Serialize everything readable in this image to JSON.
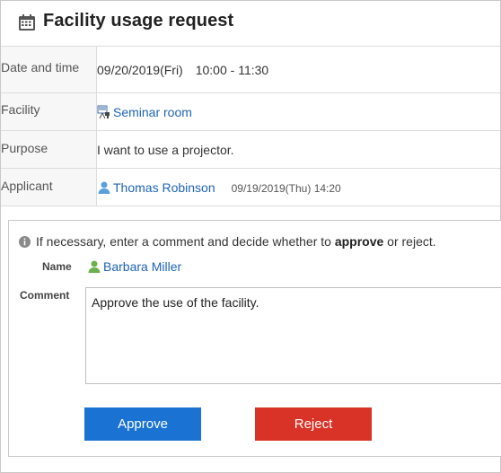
{
  "header": {
    "title": "Facility usage request",
    "icon": "calendar-icon"
  },
  "details": {
    "date_label": "Date and time",
    "date": "09/20/2019(Fri)",
    "time": "10:00 - 11:30",
    "facility_label": "Facility",
    "facility": "Seminar room",
    "facility_icon": "facility-icon",
    "purpose_label": "Purpose",
    "purpose": "I want to use a projector.",
    "applicant_label": "Applicant",
    "applicant": "Thomas Robinson",
    "applicant_icon": "user-icon",
    "applied_at": "09/19/2019(Thu) 14:20"
  },
  "approval": {
    "note_prefix": "If necessary, enter a comment and decide whether to",
    "note_approve": "approve",
    "note_suffix": "or reject.",
    "name_label": "Name",
    "name": "Barbara Miller",
    "comment_label": "Comment",
    "comment": "Approve the use of the facility.",
    "approve_label": "Approve",
    "reject_label": "Reject"
  },
  "colors": {
    "link": "#1e64b4",
    "approve": "#1a73d2",
    "reject": "#d93226",
    "user_applicant": "#5aa0dc",
    "user_approver": "#6ab04c"
  }
}
